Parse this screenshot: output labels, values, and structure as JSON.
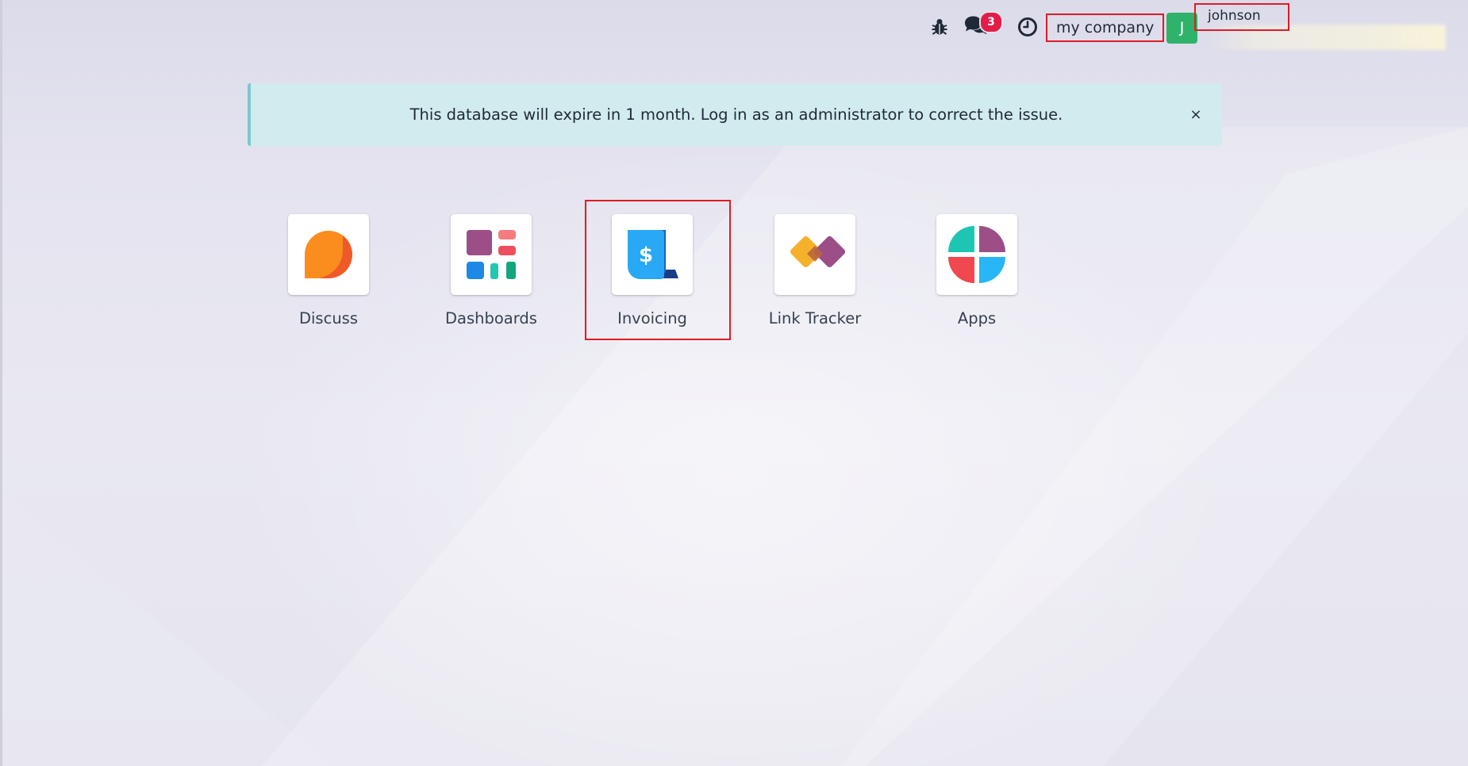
{
  "navbar": {
    "debug_icon": "bug-icon",
    "messages_icon": "chat-icon",
    "messages_badge": "3",
    "activity_icon": "clock-icon",
    "company_name": "my company",
    "avatar_initial": "J",
    "user_name": "johnson"
  },
  "alert": {
    "message": "This database will expire in 1 month. Log in as an administrator to correct the issue.",
    "close_label": "×"
  },
  "apps": [
    {
      "label": "Discuss",
      "icon": "discuss-icon"
    },
    {
      "label": "Dashboards",
      "icon": "dashboards-icon"
    },
    {
      "label": "Invoicing",
      "icon": "invoicing-icon"
    },
    {
      "label": "Link Tracker",
      "icon": "link-tracker-icon"
    },
    {
      "label": "Apps",
      "icon": "apps-icon"
    }
  ],
  "colors": {
    "highlight": "#e01b24",
    "avatar": "#2fb36a",
    "badge": "#e11d48",
    "alert_bg": "#d1ebee"
  }
}
